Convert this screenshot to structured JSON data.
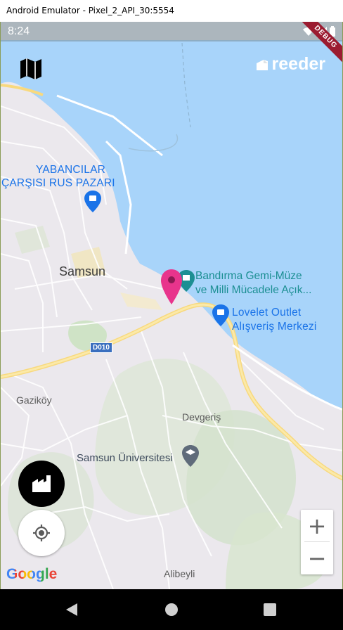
{
  "window": {
    "title": "Android Emulator - Pixel_2_API_30:5554"
  },
  "status_bar": {
    "time": "8:24",
    "debug_banner": "DEBUG",
    "icons": [
      "settings-icon",
      "wifi-icon",
      "signal-icon",
      "battery-icon"
    ]
  },
  "app": {
    "brand": "reeder"
  },
  "map": {
    "labels": {
      "bazaar_line1": "YABANCILAR",
      "bazaar_line2": "ÇARŞISI RUS PAZARI",
      "city": "Samsun",
      "museum_line1": "Bandırma Gemi-Müze",
      "museum_line2": "ve Milli Mücadele Açık...",
      "outlet_line1": "Lovelet Outlet",
      "outlet_line2": "Alışveriş Merkezi",
      "road": "D010",
      "gazikoy": "Gaziköy",
      "devgeris": "Devgeriş",
      "university": "Samsun Üniversitesi",
      "alibeyli": "Alibeyli"
    },
    "zoom_in": "+",
    "zoom_out": "−",
    "attribution": "Google"
  },
  "colors": {
    "water": "#a8d4fa",
    "land": "#ebe8ed",
    "road_major": "#f8e08e",
    "accent_pin": "#e8348c",
    "brand_white": "#ffffff"
  }
}
